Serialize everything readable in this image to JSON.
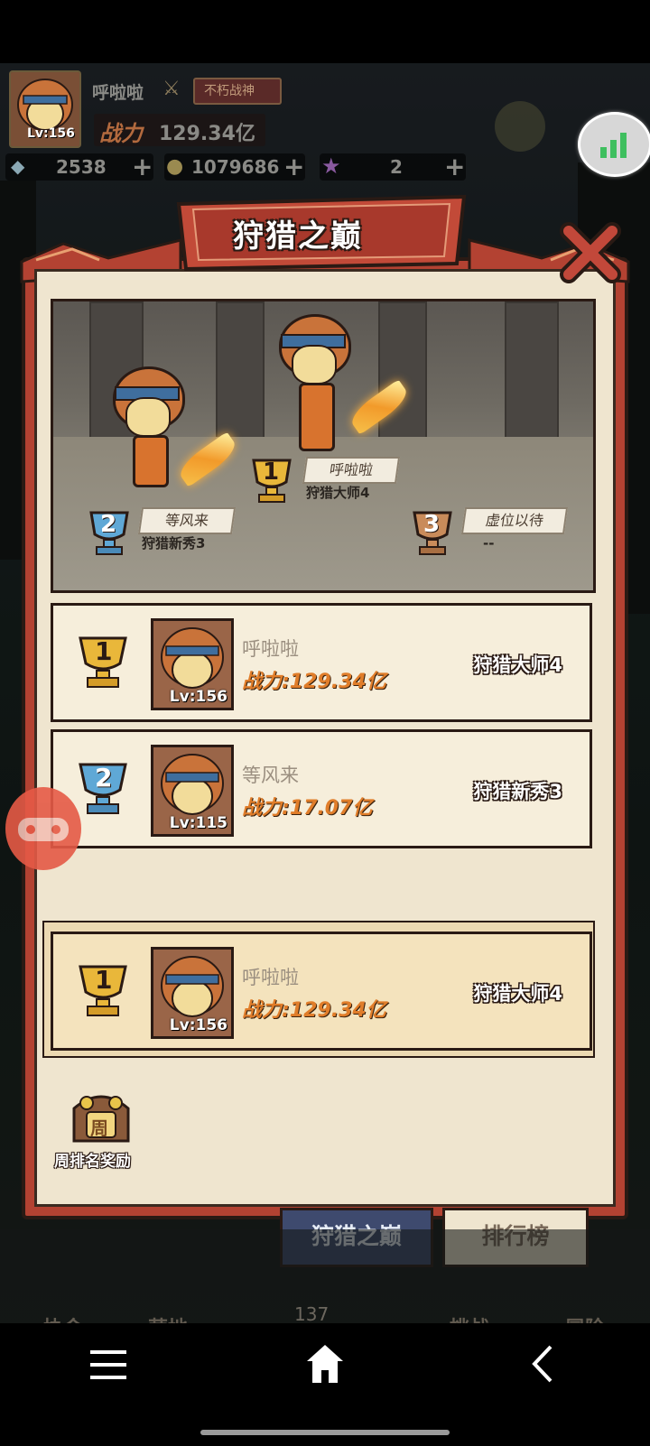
{
  "hud": {
    "player_name": "呼啦啦",
    "player_level": "Lv:156",
    "badge_title": "不朽战神",
    "power_label": "战力",
    "power_value": "129.34亿",
    "diamonds": "2538",
    "coins": "1079686",
    "stars": "2",
    "plus": "+"
  },
  "panel": {
    "title": "狩猎之巅"
  },
  "podium": {
    "first": {
      "rank": "1",
      "name": "呼啦啦",
      "title": "狩猎大师4"
    },
    "second": {
      "rank": "2",
      "name": "等风来",
      "title": "狩猎新秀3"
    },
    "third": {
      "rank": "3",
      "name": "虚位以待",
      "title": "--"
    }
  },
  "ranking": [
    {
      "rank": "1",
      "name": "呼啦啦",
      "level": "Lv:156",
      "power": "战力:129.34亿",
      "title": "狩猎大师4"
    },
    {
      "rank": "2",
      "name": "等风来",
      "level": "Lv:115",
      "power": "战力:17.07亿",
      "title": "狩猎新秀3"
    }
  ],
  "my_rank": {
    "rank": "1",
    "name": "呼啦啦",
    "level": "Lv:156",
    "power": "战力:129.34亿",
    "title": "狩猎大师4"
  },
  "weekly_reward": {
    "icon_char": "周",
    "label": "周排名奖励"
  },
  "tabs": {
    "active": "狩猎之巅",
    "other": "排行榜"
  },
  "bottom_nav": {
    "items": [
      "协会",
      "营地",
      "挑战",
      "冒险"
    ],
    "count": "137"
  },
  "colors": {
    "panel_red": "#b34232",
    "parchment": "#efe5cf",
    "gold": "#e9b73a",
    "silver_blue": "#5fa8d6",
    "bronze": "#c98b5a",
    "active_tab": "#3e4a6e"
  }
}
